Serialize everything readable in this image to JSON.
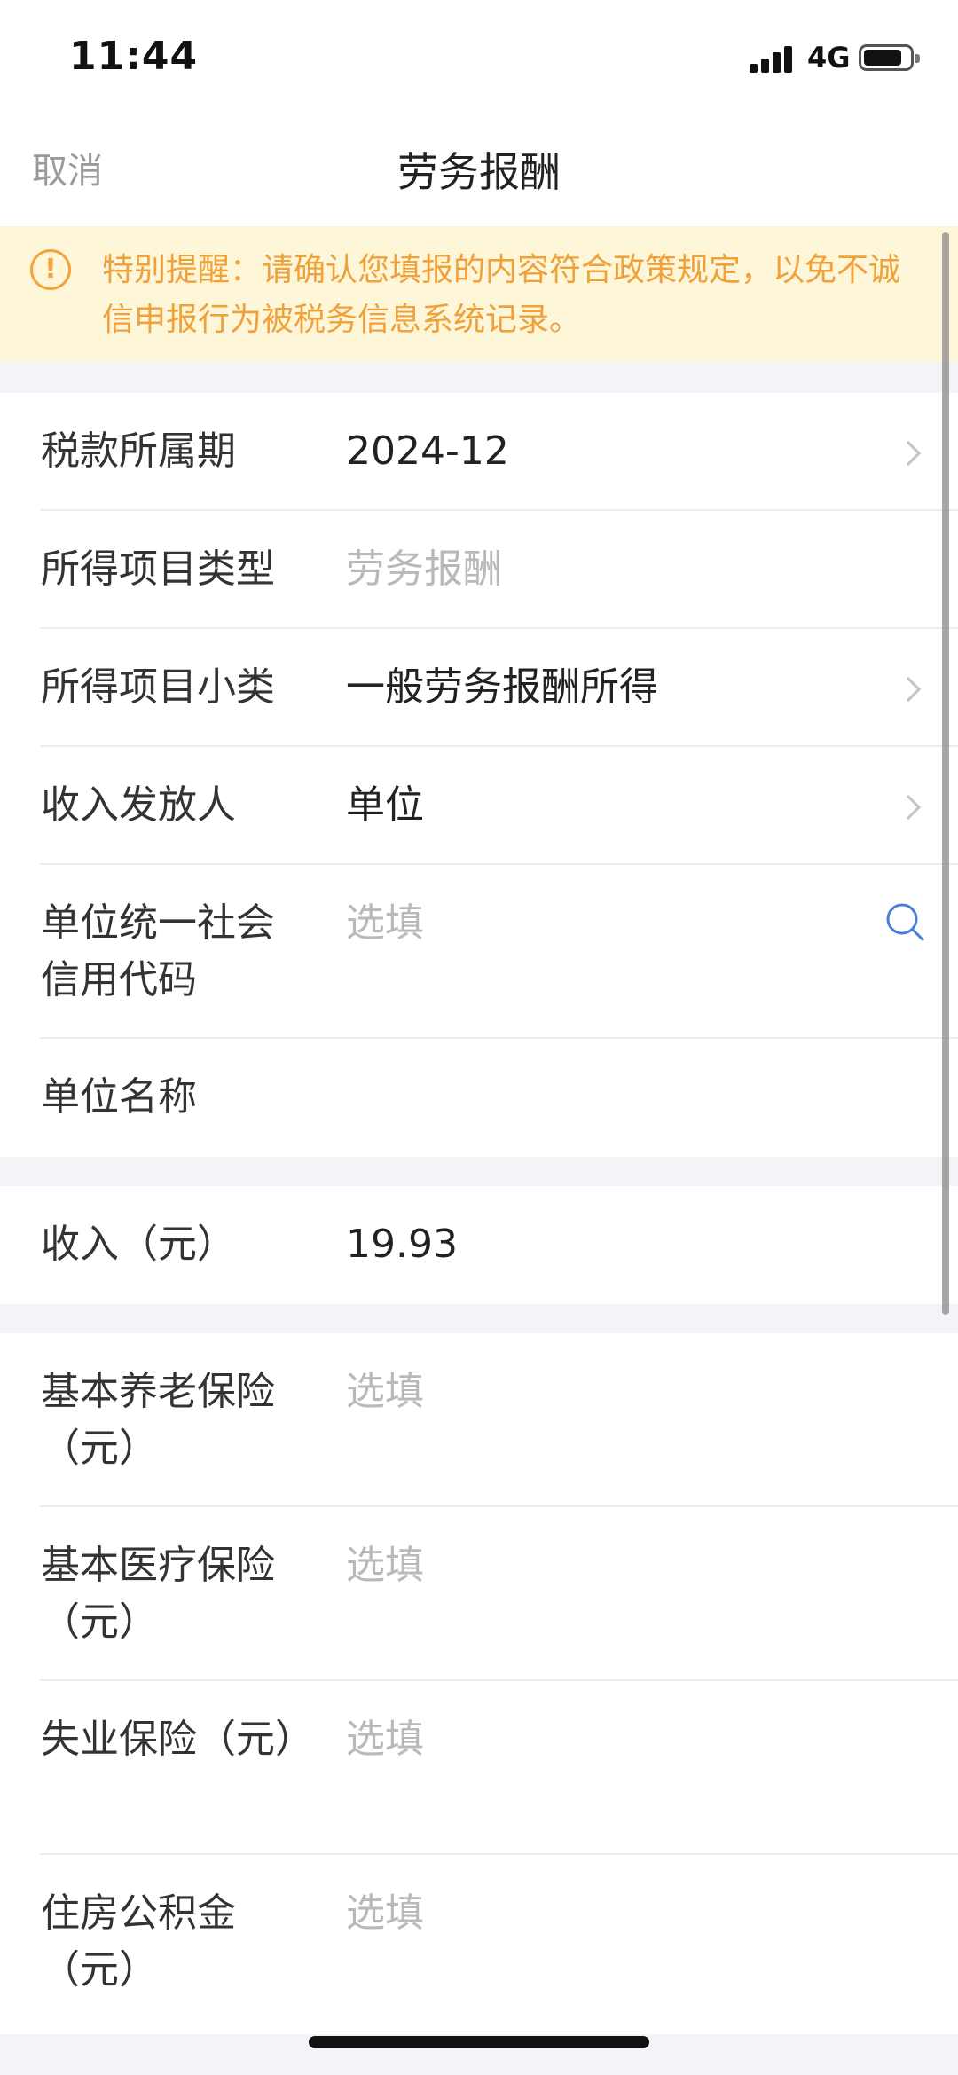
{
  "status_bar": {
    "time": "11:44",
    "network": "4G",
    "battery_level": 0.75
  },
  "nav": {
    "cancel_label": "取消",
    "title": "劳务报酬"
  },
  "notice": {
    "text": "特别提醒：请确认您填报的内容符合政策规定，以免不诚信申报行为被税务信息系统记录。",
    "color": "#f0a13a",
    "background": "#fdf6d9"
  },
  "form": {
    "period": {
      "label": "税款所属期",
      "value": "2024-12"
    },
    "income_type": {
      "label": "所得项目类型",
      "value": "劳务报酬"
    },
    "income_subtype": {
      "label": "所得项目小类",
      "value": "一般劳务报酬所得"
    },
    "payer": {
      "label": "收入发放人",
      "value": "单位"
    },
    "credit_code": {
      "label": "单位统一社会信用代码",
      "placeholder": "选填"
    },
    "unit_name": {
      "label": "单位名称",
      "value": ""
    },
    "income": {
      "label": "收入（元）",
      "value": "19.93"
    },
    "pension": {
      "label": "基本养老保险（元）",
      "placeholder": "选填"
    },
    "medical": {
      "label": "基本医疗保险（元）",
      "placeholder": "选填"
    },
    "unemployment": {
      "label": "失业保险（元）",
      "placeholder": "选填"
    },
    "housing_fund": {
      "label": "住房公积金（元）",
      "placeholder": "选填"
    }
  }
}
